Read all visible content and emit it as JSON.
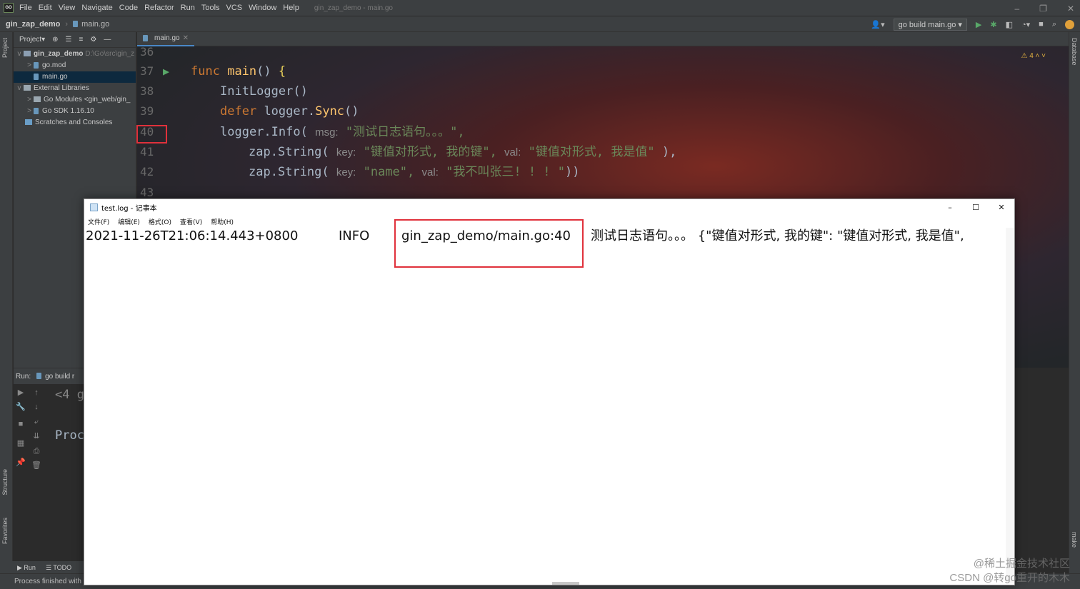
{
  "ide": {
    "logo": "GO",
    "menu": [
      "File",
      "Edit",
      "View",
      "Navigate",
      "Code",
      "Refactor",
      "Run",
      "Tools",
      "VCS",
      "Window",
      "Help"
    ],
    "window_title": "gin_zap_demo - main.go",
    "win_controls": [
      "–",
      "❐",
      "✕"
    ],
    "breadcrumb": {
      "project": "gin_zap_demo",
      "file": "main.go"
    },
    "run_config": "go build main.go",
    "project_panel": {
      "title": "Project",
      "tree": [
        {
          "label": "gin_zap_demo",
          "extra": "D:\\Go\\src\\gin_z",
          "indent": 0,
          "arrow": "v"
        },
        {
          "label": "go.mod",
          "extra": "",
          "indent": 1,
          "arrow": ">"
        },
        {
          "label": "main.go",
          "extra": "",
          "indent": 1,
          "arrow": ""
        },
        {
          "label": "External Libraries",
          "extra": "",
          "indent": 0,
          "arrow": "v"
        },
        {
          "label": "Go Modules <gin_web/gin_",
          "extra": "",
          "indent": 1,
          "arrow": ">"
        },
        {
          "label": "Go SDK 1.16.10",
          "extra": "",
          "indent": 1,
          "arrow": ">"
        },
        {
          "label": "Scratches and Consoles",
          "extra": "",
          "indent": 0,
          "arrow": ""
        }
      ]
    },
    "editor": {
      "tab": "main.go",
      "warnings": "4",
      "lines": [
        {
          "n": "36"
        },
        {
          "n": "37"
        },
        {
          "n": "38"
        },
        {
          "n": "39"
        },
        {
          "n": "40"
        },
        {
          "n": "41"
        },
        {
          "n": "42"
        },
        {
          "n": "43"
        }
      ],
      "code": {
        "l37_kw": "func",
        "l37_fn": "main",
        "l37_paren": "()",
        "l37_brace": "{",
        "l38": "InitLogger()",
        "l39_kw": "defer",
        "l39_obj": "logger.",
        "l39_fn": "Sync",
        "l39_end": "()",
        "l40_obj": "logger.Info(",
        "l40_hint": "msg:",
        "l40_str": "\"测试日志语句。。。\",",
        "l41_fn": "zap.String(",
        "l41_hint1": "key:",
        "l41_str1": "\"键值对形式, 我的键\",",
        "l41_hint2": "val:",
        "l41_str2": "\"键值对形式, 我是值\"",
        "l41_end": "),",
        "l42_fn": "zap.String(",
        "l42_hint1": "key:",
        "l42_str1": "\"name\",",
        "l42_hint2": "val:",
        "l42_str2": "\"我不叫张三! ! ! \"",
        "l42_end": "))"
      }
    },
    "run_panel": {
      "label": "Run:",
      "config": "go build r",
      "console_1": "<4 g",
      "console_2": "Proc"
    },
    "left_stripe": {
      "project": "Project",
      "structure": "Structure",
      "favorites": "Favorites"
    },
    "right_stripe": {
      "database": "Database",
      "make": "make"
    },
    "bottom_tools": {
      "run": "Run",
      "todo": "TODO"
    },
    "status": "Process finished with"
  },
  "notepad": {
    "title": "test.log - 记事本",
    "controls": [
      "–",
      "☐",
      "✕"
    ],
    "menu": [
      "文件(F)",
      "编辑(E)",
      "格式(O)",
      "查看(V)",
      "帮助(H)"
    ],
    "log": {
      "timestamp": "2021-11-26T21:06:14.443+0800",
      "level": "INFO",
      "caller": "gin_zap_demo/main.go:40",
      "message": "测试日志语句。。。 {\"键值对形式, 我的键\": \"键值对形式, 我是值\","
    }
  },
  "watermark": {
    "line1": "@稀土掘金技术社区",
    "line2": "CSDN @转go重开的木木"
  }
}
